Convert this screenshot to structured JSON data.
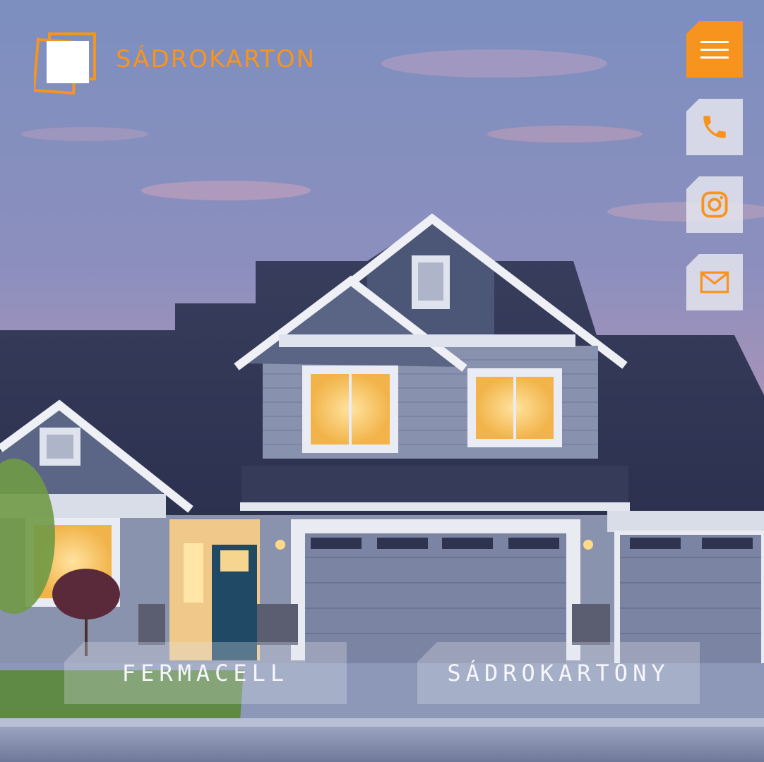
{
  "brand": {
    "name": "SÁDROKARTON",
    "logo_icon": "stacked-squares-logo",
    "accent_color": "#f7941d"
  },
  "side_actions": {
    "menu_icon": "hamburger-menu-icon",
    "phone_icon": "phone-icon",
    "instagram_icon": "instagram-icon",
    "mail_icon": "mail-icon"
  },
  "cta": {
    "left_label": "FERMACELL",
    "right_label": "SÁDROKARTONY"
  },
  "hero": {
    "image": "house-at-dusk-photo"
  }
}
